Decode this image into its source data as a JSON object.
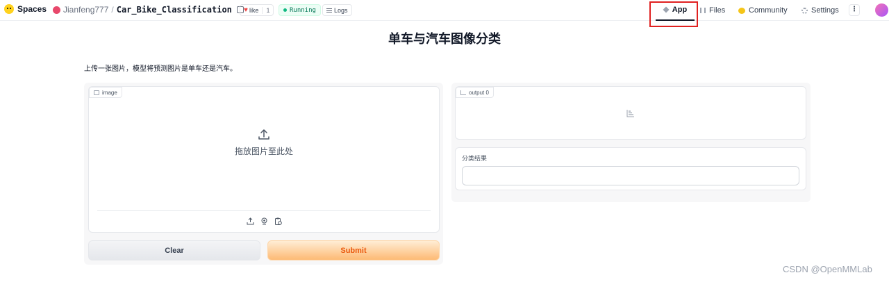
{
  "header": {
    "brand": "Spaces",
    "owner": "Jianfeng777",
    "space_name": "Car_Bike_Classification",
    "like_label": "like",
    "like_count": "1",
    "status": "Running",
    "logs_label": "Logs",
    "tabs": [
      {
        "label": "App",
        "active": true
      },
      {
        "label": "Files"
      },
      {
        "label": "Community"
      },
      {
        "label": "Settings"
      }
    ],
    "more_label": "⋮"
  },
  "main": {
    "title": "单车与汽车图像分类",
    "description": "上传一张图片，模型将预测图片是单车还是汽车。",
    "image_label": "image",
    "drop_text": "拖放图片至此处",
    "output_label": "output 0",
    "result_label": "分类结果",
    "result_value": "",
    "clear_label": "Clear",
    "submit_label": "Submit"
  },
  "watermark": "CSDN @OpenMMLab",
  "colors": {
    "highlight_box": "#e02020",
    "submit_text": "#ea580c",
    "running_dot": "#10b981"
  }
}
